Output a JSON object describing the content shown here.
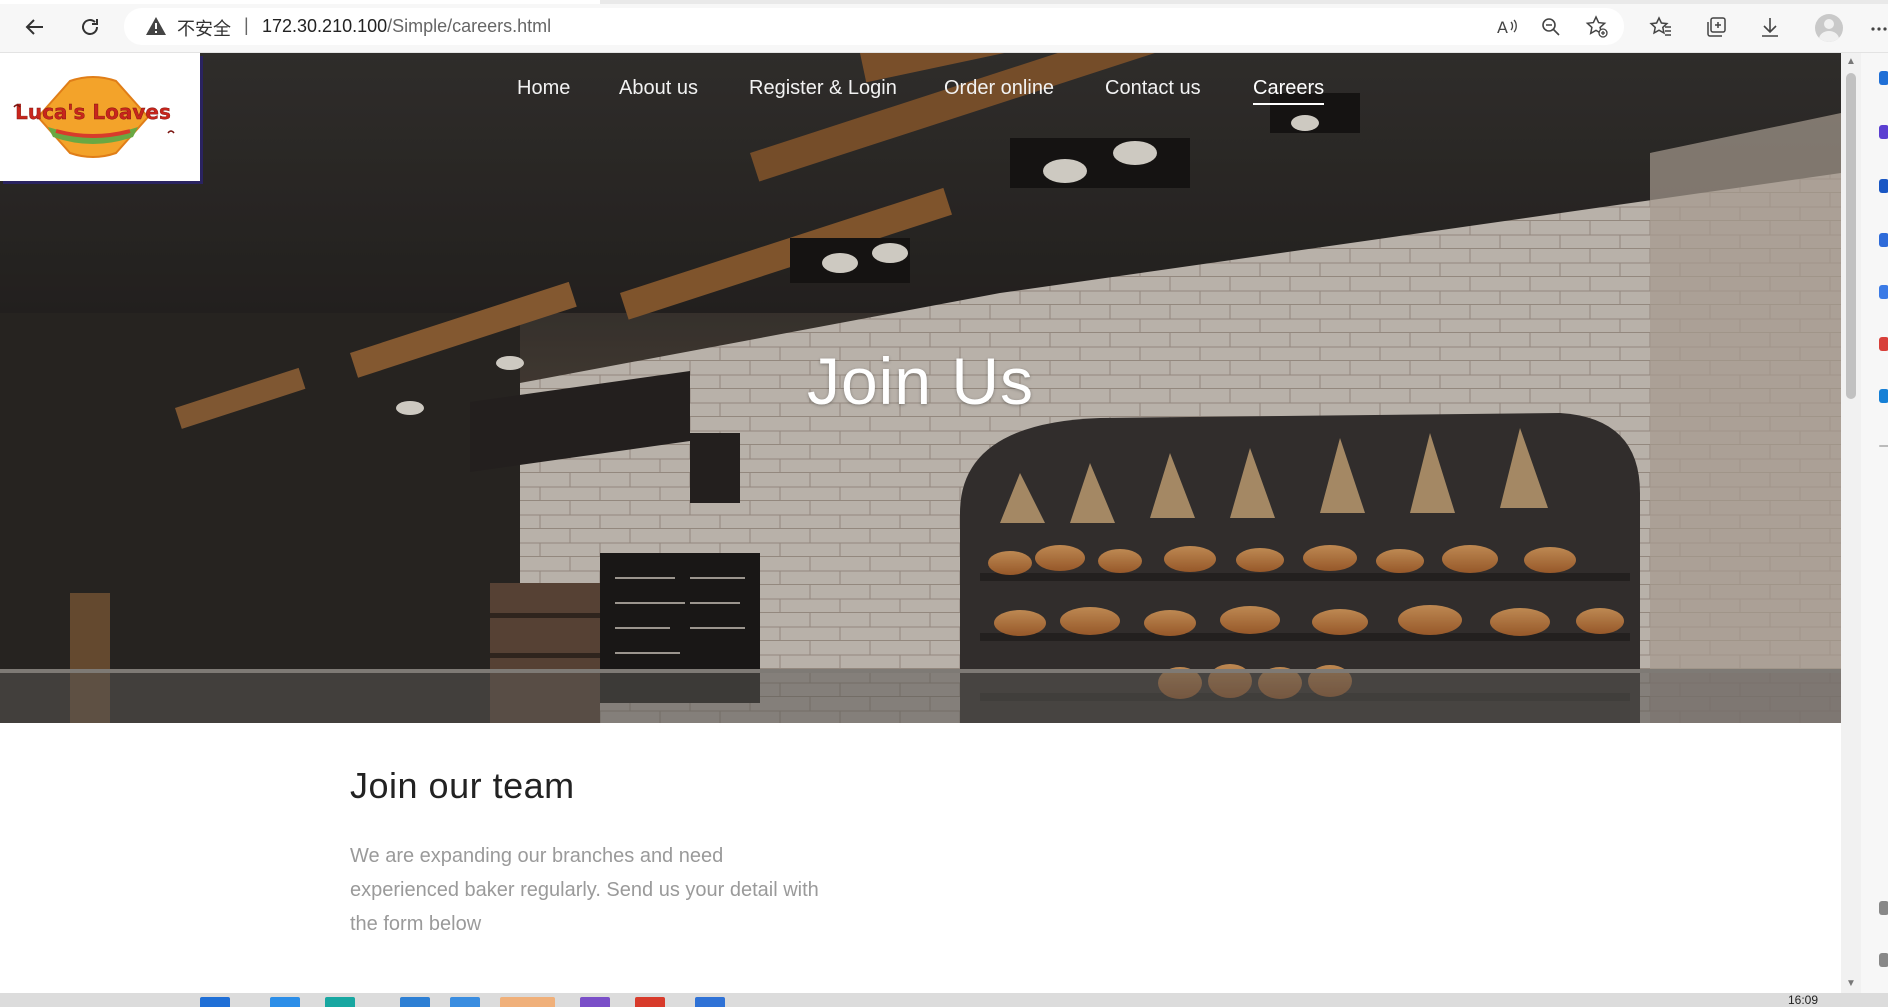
{
  "browser": {
    "security_label": "不安全",
    "separator": "|",
    "url_host": "172.30.210.100",
    "url_path": "/Simple/careers.html"
  },
  "logo": {
    "brand_name": "Luca's Loaves"
  },
  "nav": {
    "items": [
      {
        "label": "Home"
      },
      {
        "label": "About us"
      },
      {
        "label": "Register & Login"
      },
      {
        "label": "Order online"
      },
      {
        "label": "Contact us"
      },
      {
        "label": "Careers",
        "active": true
      }
    ]
  },
  "hero": {
    "title": "Join Us"
  },
  "content": {
    "section_title": "Join our team",
    "section_text": "We are expanding our branches and need experienced baker regularly. Send us your detail with the form below"
  },
  "taskbar": {
    "clock": "16:09"
  },
  "colors": {
    "nav_text": "#f2f2f2",
    "body_text": "#9a9a9a",
    "heading": "#222222",
    "logo_shadow": "#2a2360"
  },
  "icons": {
    "back": "back-arrow-icon",
    "refresh": "refresh-icon",
    "warning": "warning-icon",
    "read_aloud": "read-aloud-icon",
    "zoom": "zoom-out-icon",
    "add_favorite": "add-favorite-icon",
    "favorites": "favorites-icon",
    "collections": "collections-icon",
    "downloads": "download-icon",
    "profile": "profile-avatar-icon",
    "menu": "more-menu-icon"
  }
}
